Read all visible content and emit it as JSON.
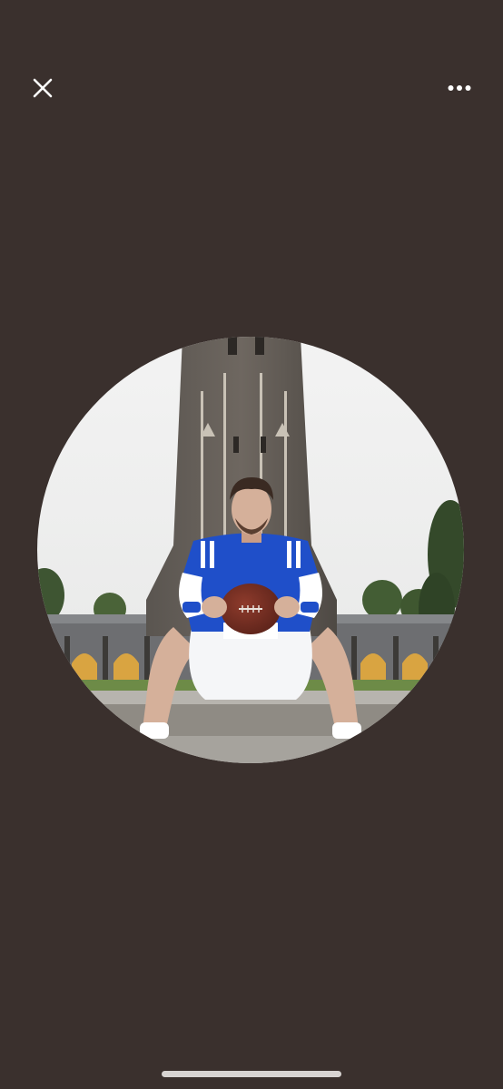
{
  "viewer": {
    "close_icon": "close-icon",
    "more_icon": "more-horizontal-icon",
    "photo": {
      "shape": "circle",
      "subject": "profile-photo"
    }
  },
  "colors": {
    "background": "#3a302d",
    "icon": "#ffffff",
    "home_indicator": "#d8d4d2",
    "jersey_blue": "#1f4fc9"
  }
}
